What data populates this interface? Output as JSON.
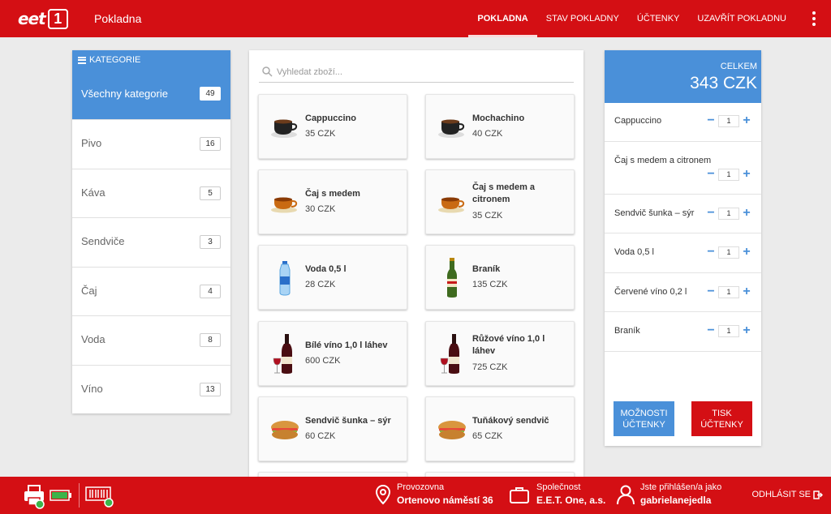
{
  "header": {
    "logo_text": "eet",
    "logo_number": "1",
    "app_title": "Pokladna",
    "nav": [
      "POKLADNA",
      "STAV POKLADNY",
      "ÚČTENKY",
      "UZAVŘÍT POKLADNU"
    ],
    "active_nav": "POKLADNA"
  },
  "categories": {
    "title": "KATEGORIE",
    "active": {
      "label": "Všechny kategorie",
      "count": "49"
    },
    "items": [
      {
        "label": "Pivo",
        "count": "16"
      },
      {
        "label": "Káva",
        "count": "5"
      },
      {
        "label": "Sendviče",
        "count": "3"
      },
      {
        "label": "Čaj",
        "count": "4"
      },
      {
        "label": "Voda",
        "count": "8"
      },
      {
        "label": "Víno",
        "count": "13"
      }
    ]
  },
  "search": {
    "placeholder": "Vyhledat zboží..."
  },
  "products": [
    {
      "name": "Cappuccino",
      "price": "35 CZK",
      "icon": "coffee-cup-icon"
    },
    {
      "name": "Mochachino",
      "price": "40 CZK",
      "icon": "coffee-cup-icon"
    },
    {
      "name": "Čaj s medem",
      "price": "30 CZK",
      "icon": "tea-cup-icon"
    },
    {
      "name": "Čaj s medem a citronem",
      "price": "35 CZK",
      "icon": "tea-cup-icon"
    },
    {
      "name": "Voda 0,5 l",
      "price": "28 CZK",
      "icon": "water-bottle-icon"
    },
    {
      "name": "Braník",
      "price": "135 CZK",
      "icon": "beer-bottle-icon"
    },
    {
      "name": "Bílé víno 1,0 l láhev",
      "price": "600 CZK",
      "icon": "wine-bottle-icon"
    },
    {
      "name": "Růžové víno 1,0 l láhev",
      "price": "725 CZK",
      "icon": "wine-bottle-icon"
    },
    {
      "name": "Sendvič šunka – sýr",
      "price": "60 CZK",
      "icon": "sandwich-icon"
    },
    {
      "name": "Tuňákový sendvič",
      "price": "65 CZK",
      "icon": "sandwich-icon"
    }
  ],
  "cart": {
    "total_label": "CELKEM",
    "total": "343 CZK",
    "items": [
      {
        "name": "Cappuccino",
        "qty": "1"
      },
      {
        "name": "Čaj s medem a citronem",
        "qty": "1"
      },
      {
        "name": "Sendvič šunka – sýr",
        "qty": "1"
      },
      {
        "name": "Voda 0,5 l",
        "qty": "1"
      },
      {
        "name": "Červené víno 0,2 l",
        "qty": "1"
      },
      {
        "name": "Braník",
        "qty": "1"
      }
    ],
    "options_button": "MOŽNOSTI ÚČTENKY",
    "print_button": "TISK ÚČTENKY",
    "minus_glyph": "−",
    "plus_glyph": "+"
  },
  "footer": {
    "location_label": "Provozovna",
    "location_value": "Ortenovo náměstí 36",
    "company_label": "Společnost",
    "company_value": "E.E.T. One, a.s.",
    "user_label": "Jste přihlášen/a jako",
    "user_value": "gabrielanejedla",
    "logout": "ODHLÁSIT SE"
  },
  "colors": {
    "brand_red": "#d40f14",
    "accent_blue": "#4a90d9",
    "status_green": "#3cb44a"
  }
}
